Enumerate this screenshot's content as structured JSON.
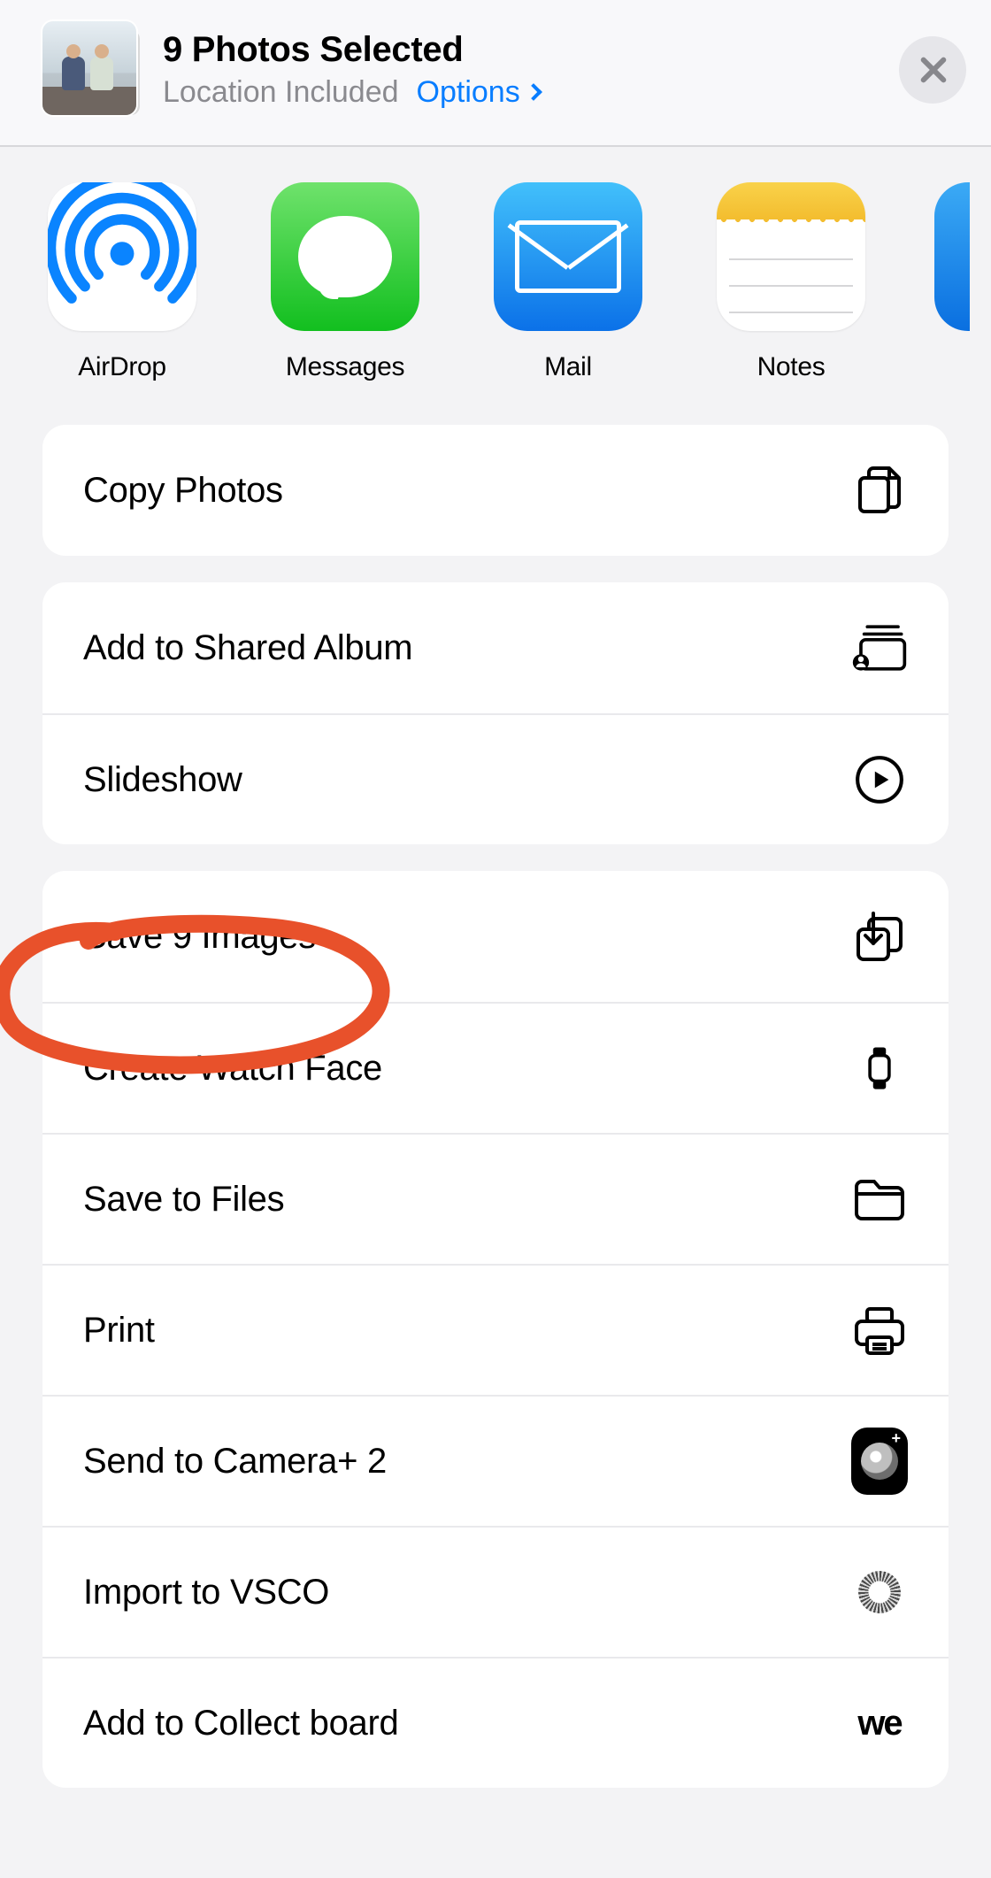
{
  "header": {
    "title": "9 Photos Selected",
    "subtitle": "Location Included",
    "options_label": "Options"
  },
  "apps": [
    {
      "id": "airdrop",
      "label": "AirDrop"
    },
    {
      "id": "messages",
      "label": "Messages"
    },
    {
      "id": "mail",
      "label": "Mail"
    },
    {
      "id": "notes",
      "label": "Notes"
    }
  ],
  "actions": {
    "copy_photos": "Copy Photos",
    "shared_album": "Add to Shared Album",
    "slideshow": "Slideshow",
    "save_images": "Save 9 Images",
    "watch_face": "Create Watch Face",
    "save_files": "Save to Files",
    "print": "Print",
    "camera_plus": "Send to Camera+ 2",
    "vsco": "Import to VSCO",
    "collect_board": "Add to Collect board"
  },
  "annotation": {
    "target": "save_images",
    "color": "#e8512b"
  }
}
